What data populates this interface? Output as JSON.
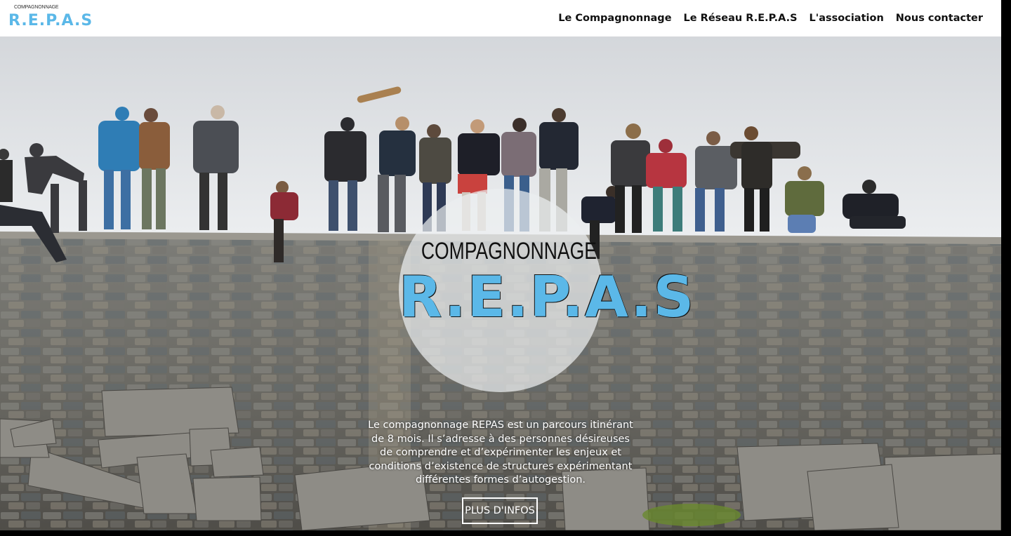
{
  "header": {
    "logo": {
      "top_text": "COMPAGNONNAGE",
      "main_text": "R.E.P.A.S"
    },
    "nav": [
      {
        "label": "Le Compagnonnage"
      },
      {
        "label": "Le Réseau R.E.P.A.S"
      },
      {
        "label": "L'association"
      },
      {
        "label": "Nous contacter"
      }
    ]
  },
  "hero": {
    "badge": {
      "top_text": "COMPAGNONNAGE",
      "main_text": "R.E.P.A.S"
    },
    "description": "Le compagnonnage REPAS est un parcours itinérant de 8 mois. Il s’adresse à des personnes désireuses de comprendre et d’expérimenter les enjeux et conditions d’existence de structures expérimentant différentes formes d’autogestion.",
    "cta_label": "PLUS D'INFOS"
  },
  "colors": {
    "accent_blue": "#5bb8e8",
    "header_bg": "#ffffff",
    "nav_text": "#111111"
  }
}
